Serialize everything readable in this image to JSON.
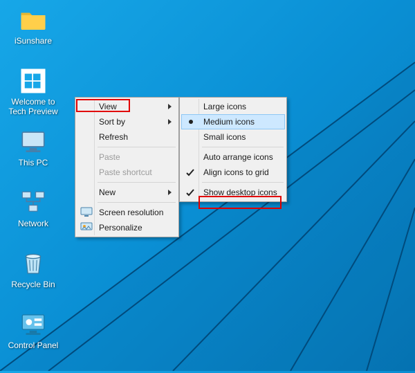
{
  "desktop": {
    "icons": [
      {
        "label": "iSunshare"
      },
      {
        "label": "Welcome to Tech Preview"
      },
      {
        "label": "This PC"
      },
      {
        "label": "Network"
      },
      {
        "label": "Recycle Bin"
      },
      {
        "label": "Control Panel"
      }
    ]
  },
  "context_menu": {
    "view": "View",
    "sort_by": "Sort by",
    "refresh": "Refresh",
    "paste": "Paste",
    "paste_shortcut": "Paste shortcut",
    "new": "New",
    "screen_res": "Screen resolution",
    "personalize": "Personalize"
  },
  "view_submenu": {
    "large": "Large icons",
    "medium": "Medium icons",
    "small": "Small icons",
    "auto_arrange": "Auto arrange icons",
    "align_grid": "Align icons to grid",
    "show_desktop": "Show desktop icons",
    "selected_size": "medium",
    "align_grid_checked": true,
    "show_desktop_checked": true
  }
}
